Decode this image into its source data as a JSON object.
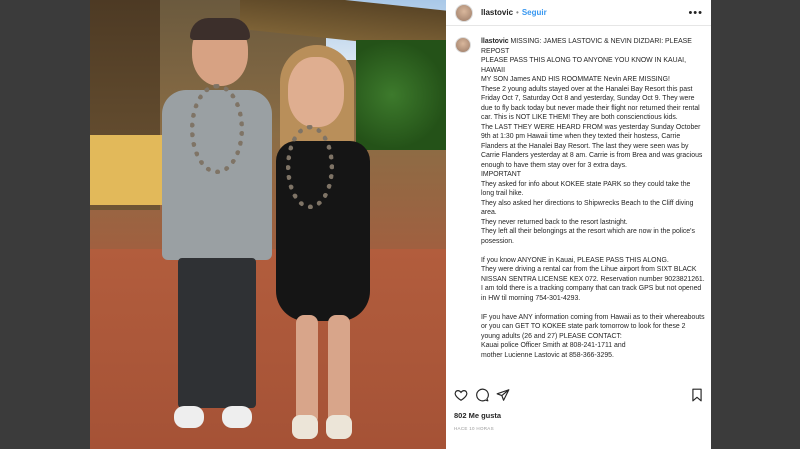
{
  "header": {
    "username": "llastovic",
    "separator": "•",
    "follow_label": "Seguir",
    "more_label": "•••"
  },
  "caption": {
    "username": "llastovic",
    "text": " MISSING: JAMES LASTOVIC & NEVIN DIZDARI: PLEASE REPOST\nPLEASE PASS THIS ALONG TO ANYONE YOU KNOW IN KAUAI, HAWAII\nMY SON James AND HIS ROOMMATE Nevin ARE MISSING!\nThese 2 young adults stayed over at the Hanalei Bay Resort this past Friday Oct 7, Saturday Oct 8 and yesterday, Sunday Oct 9. They were due to fly back today but never made their flight nor returned their rental car. This is NOT LIKE THEM! They are both conscienctious kids.\nThe LAST THEY WERE HEARD FROM was yesterday Sunday October 9th at 1:30 pm Hawaii time when they texted their hostess, Carrie Flanders at the Hanalei Bay Resort. The last they were seen was by Carrie Flanders yesterday at 8 am. Carrie is from Brea and was gracious enough to have them stay over for 3 extra days.\nIMPORTANT\nThey asked for info about KOKEE state PARK so they could take the long trail hike.\nThey also asked her directions to Shipwrecks Beach to the Cliff diving area.\nThey never returned back to the resort lastnight.\nThey left all their belongings at the resort which are now in the police's posession.\n\nIf you know ANYONE in Kauai, PLEASE PASS THIS ALONG.\nThey were driving a rental car from the Lihue airport from SIXT BLACK NISSAN SENTRA LICENSE KEX 072. Reservation number 9023821261. I am told there is a tracking company that can track GPS but not opened in HW til morning 754-301-4293.\n\nIF you have ANY information coming from Hawaii as to their whereabouts or you can GET TO KOKEE state park tomorrow to look for these 2 young adults (26 and 27) PLEASE CONTACT:\nKauai police Officer Smith at 808-241-1711 and\nmother Lucienne Lastovic at 858-366-3295."
  },
  "actions": {
    "like_icon": "heart-icon",
    "comment_icon": "comment-icon",
    "share_icon": "send-icon",
    "save_icon": "bookmark-icon"
  },
  "likes_text": "802 Me gusta",
  "timestamp": "HACE 10 HORAS",
  "colors": {
    "follow": "#3897f0",
    "page_bg": "#3b3b3b"
  }
}
